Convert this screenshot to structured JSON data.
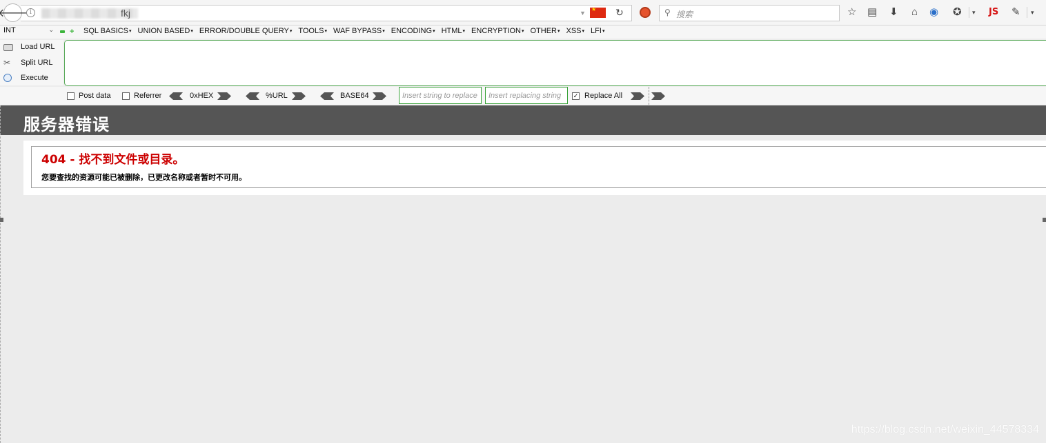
{
  "browser": {
    "url_suffix": "fkj",
    "search_placeholder": "搜索",
    "js_badge": "JS"
  },
  "hackbar": {
    "type_select": "INT",
    "menus": [
      "SQL BASICS",
      "UNION BASED",
      "ERROR/DOUBLE QUERY",
      "TOOLS",
      "WAF BYPASS",
      "ENCODING",
      "HTML",
      "ENCRYPTION",
      "OTHER",
      "XSS",
      "LFI"
    ],
    "load_url": "Load URL",
    "split_url": "Split URL",
    "execute": "Execute",
    "post_data": "Post data",
    "referrer": "Referrer",
    "hex": "0xHEX",
    "url_enc": "%URL",
    "base64": "BASE64",
    "replace_placeholder": "Insert string to replace",
    "replacing_placeholder": "Insert replacing string",
    "replace_all": "Replace All",
    "post_data_checked": false,
    "referrer_checked": false,
    "replace_all_checked": true
  },
  "page": {
    "header_title": "服务器错误",
    "error_title": "404 - 找不到文件或目录。",
    "error_description": "您要查找的资源可能已被删除，已更改名称或者暂时不可用。"
  },
  "watermark": "https://blog.csdn.net/weixin_44578334"
}
